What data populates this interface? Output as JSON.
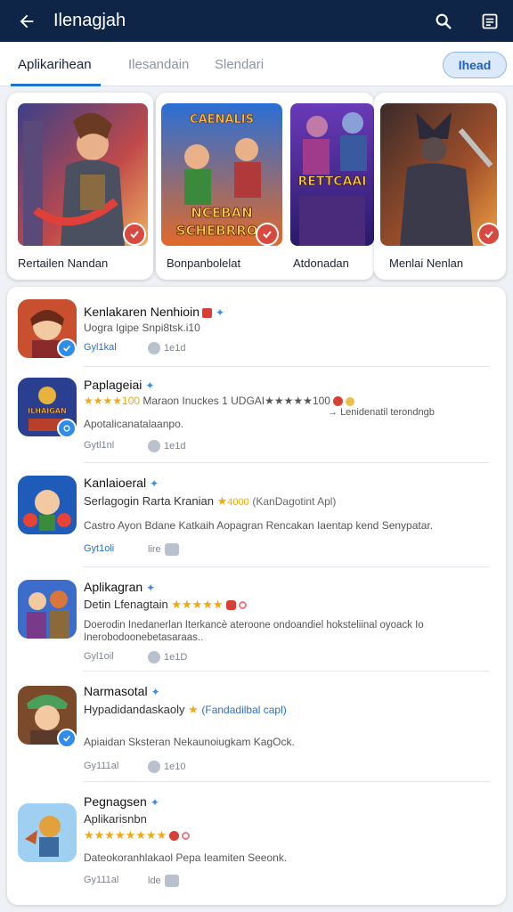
{
  "header": {
    "title": "Ilenagjah",
    "back_icon": "arrow-left-icon",
    "search_icon": "search-icon",
    "menu_icon": "list-icon"
  },
  "tabs": {
    "items": [
      {
        "label": "Aplikarihean",
        "active": true
      },
      {
        "label": "Ilesandain",
        "active": false
      },
      {
        "label": "Slendari",
        "active": false
      }
    ],
    "pill": "Ihead"
  },
  "featured": [
    {
      "name": "Rertailen Nandan"
    },
    {
      "name": "Bonpanbolelat",
      "art_text_top": "CAENALIS",
      "art_text_bottom": "NCEBAN SCHEBRROS"
    },
    {
      "name": "Atdonadan",
      "art_text": "RETTCAAI"
    },
    {
      "name": "Menlai Nenlan"
    }
  ],
  "apps": [
    {
      "title": "Kenlakaren Nenhioin",
      "line1": "Uogra Igipe Snpi8tsk.i10",
      "line2": "",
      "meta1": "Gyl1kal",
      "meta2": "1e1d",
      "colors": {
        "bg": "#c9502f",
        "accent": "#f2c070"
      }
    },
    {
      "title": "Paplageiai",
      "line1_stars": "★★★★100",
      "line1_text": "Maraon  Inuckes  1  UDGAI★★★★★100",
      "line1_extra": "Lenidenatil terondngb",
      "line2": "Apotalicanatalaanpo.",
      "meta1": "Gytl1nl",
      "meta2": "1e1d",
      "icon_text": "ILHAIGAN",
      "colors": {
        "bg": "#2a3f8f",
        "accent": "#e8b33a"
      }
    },
    {
      "title": "Kanlaioeral",
      "line1": "Serlagogin  Rarta  Kranian",
      "line1_rating": "4000",
      "line1_link": "(KanDagotint Apl)",
      "line2": "Castro  Ayon Bdane  Katkaih  Aopagran  Rencakan  Iaentap kend  Senypatar.",
      "meta1": "Gyt1oli",
      "meta2": "lire",
      "colors": {
        "bg": "#1f5bb8",
        "accent": "#e64436"
      }
    },
    {
      "title": "Aplikagran",
      "line1": "Detin Lfenagtain",
      "line1_stars": "★★★★★",
      "line2": "Doerodin Inedanerlan Iterkancè ateroone ondoandiel hoksteliinal oyoack Io",
      "line3": "Inerobodoonebetasaraas..",
      "meta1": "Gyl1oil",
      "meta2": "1e1D",
      "colors": {
        "bg": "#3c6dcb",
        "accent": "#d9763a"
      }
    },
    {
      "title": "Narmasotal",
      "line1": "Hypadidandaskaoly",
      "line1_link": "(Fandadilbal capl)",
      "line2": "Apiaidan Sksteran Nekaunoiugkam KagOck.",
      "meta1": "Gy111al",
      "meta2": "1e10",
      "colors": {
        "bg": "#7a4a2a",
        "accent": "#4aa05a"
      }
    },
    {
      "title": "Pegnagsen",
      "line1": "Aplikarisnbn",
      "line1_stars": "★★★★★★★★",
      "line2": "Dateokoranhlakaol  Pepa  Ieamiten  Seeonk.",
      "meta1": "Gy111al",
      "meta2": "lde",
      "colors": {
        "bg": "#5fa8e6",
        "accent": "#e2a13a"
      }
    }
  ]
}
